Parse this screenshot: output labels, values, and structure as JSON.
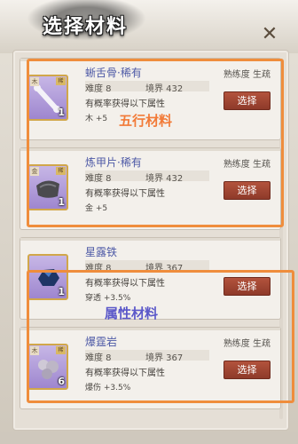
{
  "header": {
    "title": "选择材料",
    "close_symbol": "✕"
  },
  "items": [
    {
      "name": "蜥舌骨·稀有",
      "mastery": "熟练度 生疏",
      "difficulty": "难度 8",
      "realm": "境界 432",
      "desc": "有概率获得以下属性",
      "bonus": "木 +5",
      "button": "选择",
      "qty": "1",
      "icon": "bone-icon",
      "corner": "木",
      "badge": "稀"
    },
    {
      "name": "炼甲片·稀有",
      "mastery": "熟练度 生疏",
      "difficulty": "难度 8",
      "realm": "境界 432",
      "desc": "有概率获得以下属性",
      "bonus": "金 +5",
      "button": "选择",
      "qty": "1",
      "icon": "armor-plate-icon",
      "corner": "金",
      "badge": "稀"
    },
    {
      "name": "星露铁",
      "mastery": "熟练度 生疏",
      "difficulty": "难度 8",
      "realm": "境界 367",
      "desc": "有概率获得以下属性",
      "bonus": "穿透 +3.5%",
      "button": "选择",
      "qty": "1",
      "icon": "iron-ore-icon",
      "corner": "",
      "badge": ""
    },
    {
      "name": "爆霆岩",
      "mastery": "熟练度 生疏",
      "difficulty": "难度 8",
      "realm": "境界 367",
      "desc": "有概率获得以下属性",
      "bonus": "爆伤 +3.5%",
      "button": "选择",
      "qty": "6",
      "icon": "rock-icon",
      "corner": "木",
      "badge": "稀"
    }
  ],
  "annotations": {
    "wuxing": "五行材料",
    "attribute": "属性材料"
  },
  "colors": {
    "accent_orange": "#ef8d3c",
    "button_red": "#9c4130",
    "name_blue": "#4d59a6",
    "annot_blue": "#5b58c9"
  }
}
